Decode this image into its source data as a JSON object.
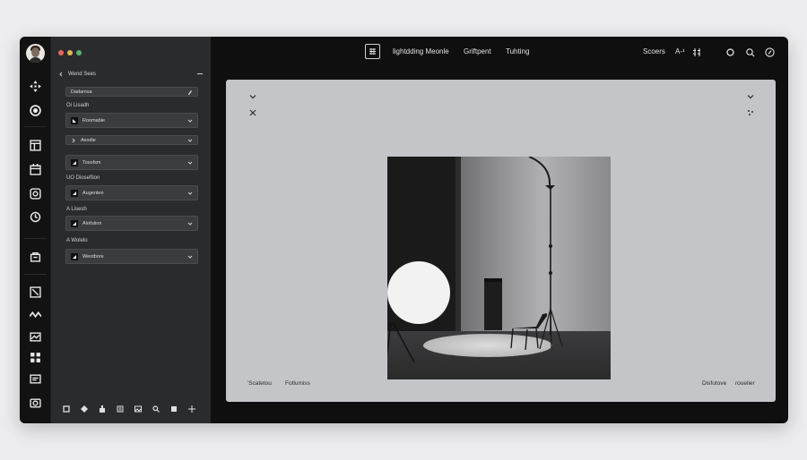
{
  "panel": {
    "title": "Wend Sees",
    "field1": "Dadamsa",
    "section1_label": "Oi Lisadh",
    "field2": "Roomable",
    "collapsed_label": "Aesdie",
    "field3": "Tosofsm",
    "section2_label": "UO Dioseftion",
    "field4": "Augenten",
    "section3_label": "A Lisesh",
    "field5": "Alofution",
    "section4_label": "A Wolelo",
    "field6": "Weotbore"
  },
  "topbar": {
    "title1": "lightdding Meonle",
    "title2": "Griftpent",
    "title3": "Tuhting",
    "right_label": "Scoers",
    "zoom": "A-¹"
  },
  "canvas": {
    "left1": "'Scatetou",
    "left2": "Fotlumiss",
    "right1": "Disfutove",
    "right2": "rouelier"
  },
  "colors": {
    "dot_red": "#e46a5d",
    "dot_yellow": "#e7b34f",
    "dot_green": "#5ab56d"
  },
  "icons": [
    "avatar",
    "move-icon",
    "circle-icon",
    "layout-icon",
    "calendar-icon",
    "target-icon",
    "clock-icon",
    "lock-icon",
    "frame-icon",
    "wave-icon",
    "chart-icon",
    "grid-icon",
    "message-icon",
    "camera-icon"
  ]
}
